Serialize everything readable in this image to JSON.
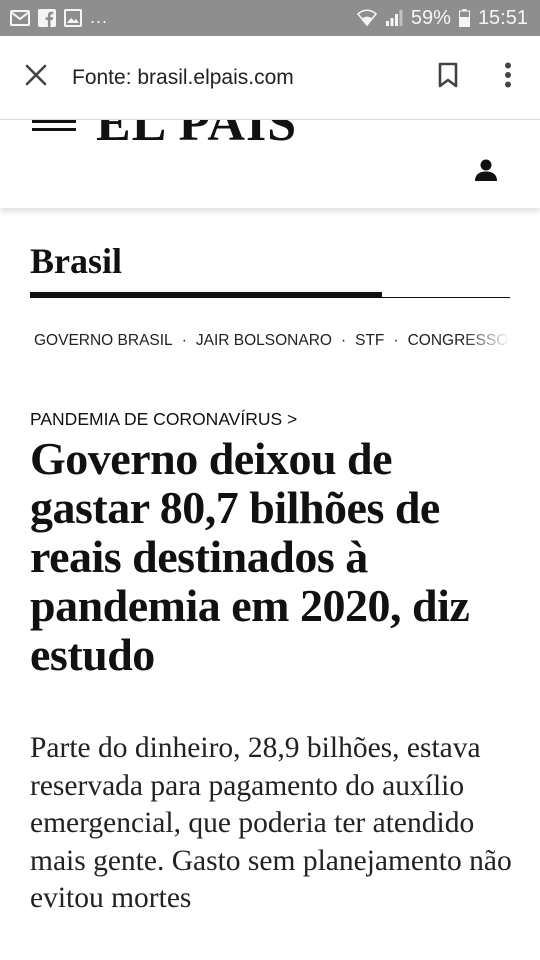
{
  "status_bar": {
    "left_icons": [
      "mail-icon",
      "facebook-icon",
      "image-icon"
    ],
    "overflow_dots": "...",
    "battery_percent": "59%",
    "time": "15:51",
    "right_icons": [
      "wifi-icon",
      "signal-icon",
      "battery-icon"
    ]
  },
  "browser": {
    "source": "Fonte: brasil.elpais.com",
    "icons": [
      "close-icon",
      "bookmark-icon",
      "more-vert-icon"
    ]
  },
  "site": {
    "logo": "EL PAÍS",
    "icons": [
      "menu-icon",
      "user-icon"
    ]
  },
  "section": {
    "title": "Brasil",
    "tags": [
      "GOVERNO BRASIL",
      "JAIR BOLSONARO",
      "STF",
      "CONGRESSO NACIONAL"
    ],
    "separator": "·"
  },
  "article": {
    "kicker": "PANDEMIA DE CORONAVÍRUS >",
    "headline": "Governo deixou de gastar 80,7 bilhões de reais destinados à pandemia em 2020, diz estudo",
    "standfirst": "Parte do dinheiro, 28,9 bilhões, estava reservada para pagamento do auxílio emergencial, que poderia ter atendido mais gente. Gasto sem planejamento não evitou mortes"
  },
  "colors": {
    "status_bar_bg": "#8e8e8e",
    "text": "#111111",
    "background": "#ffffff"
  }
}
